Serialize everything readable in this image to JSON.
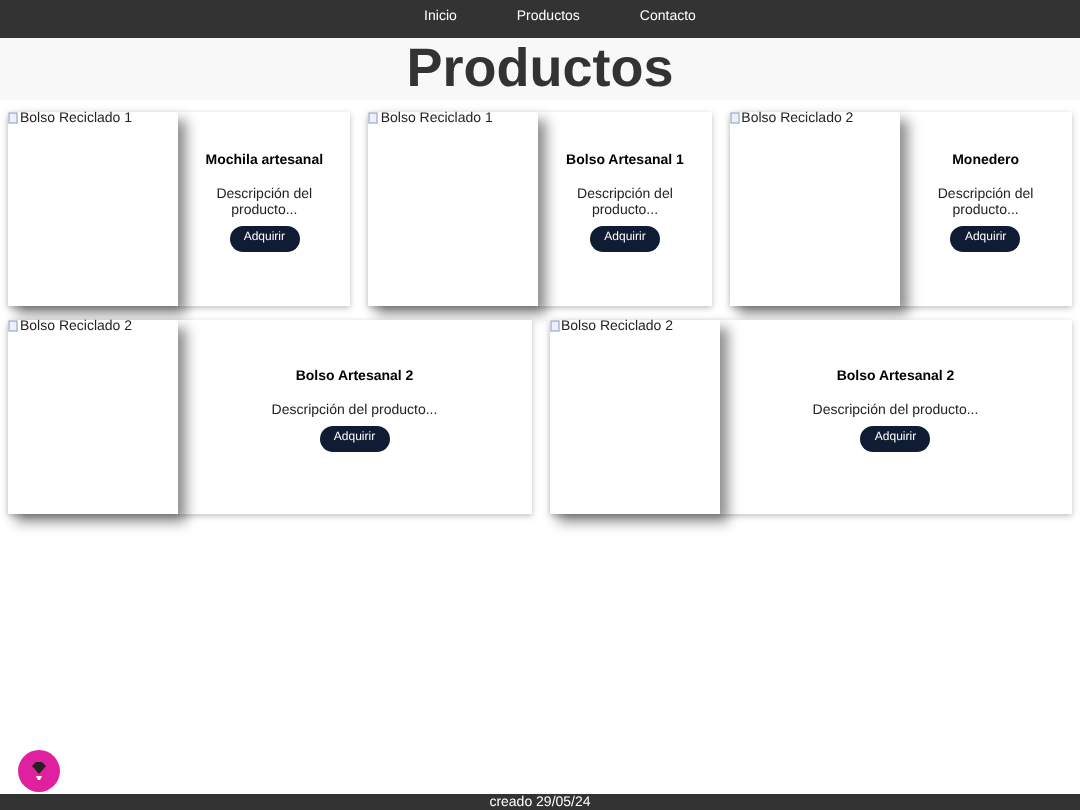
{
  "nav": [
    {
      "label": "Inicio"
    },
    {
      "label": "Productos"
    },
    {
      "label": "Contacto"
    }
  ],
  "title": "Productos",
  "product_rows": [
    [
      {
        "image_alt": "Bolso Reciclado 1",
        "name": "Mochila artesanal",
        "description": "Descripción del producto...",
        "button": "Adquirir"
      },
      {
        "image_alt": "Bolso Reciclado 1",
        "name": "Bolso Artesanal 1",
        "description": "Descripción del producto...",
        "button": "Adquirir"
      },
      {
        "image_alt": "Bolso Reciclado 2",
        "name": "Monedero",
        "description": "Descripción del producto...",
        "button": "Adquirir"
      }
    ],
    [
      {
        "image_alt": "Bolso Reciclado 2",
        "name": "Bolso Artesanal 2",
        "description": "Descripción del producto...",
        "button": "Adquirir"
      },
      {
        "image_alt": "Bolso Reciclado 2",
        "name": "Bolso Artesanal 2",
        "description": "Descripción del producto...",
        "button": "Adquirir"
      }
    ]
  ],
  "footer": "creado 29/05/24"
}
